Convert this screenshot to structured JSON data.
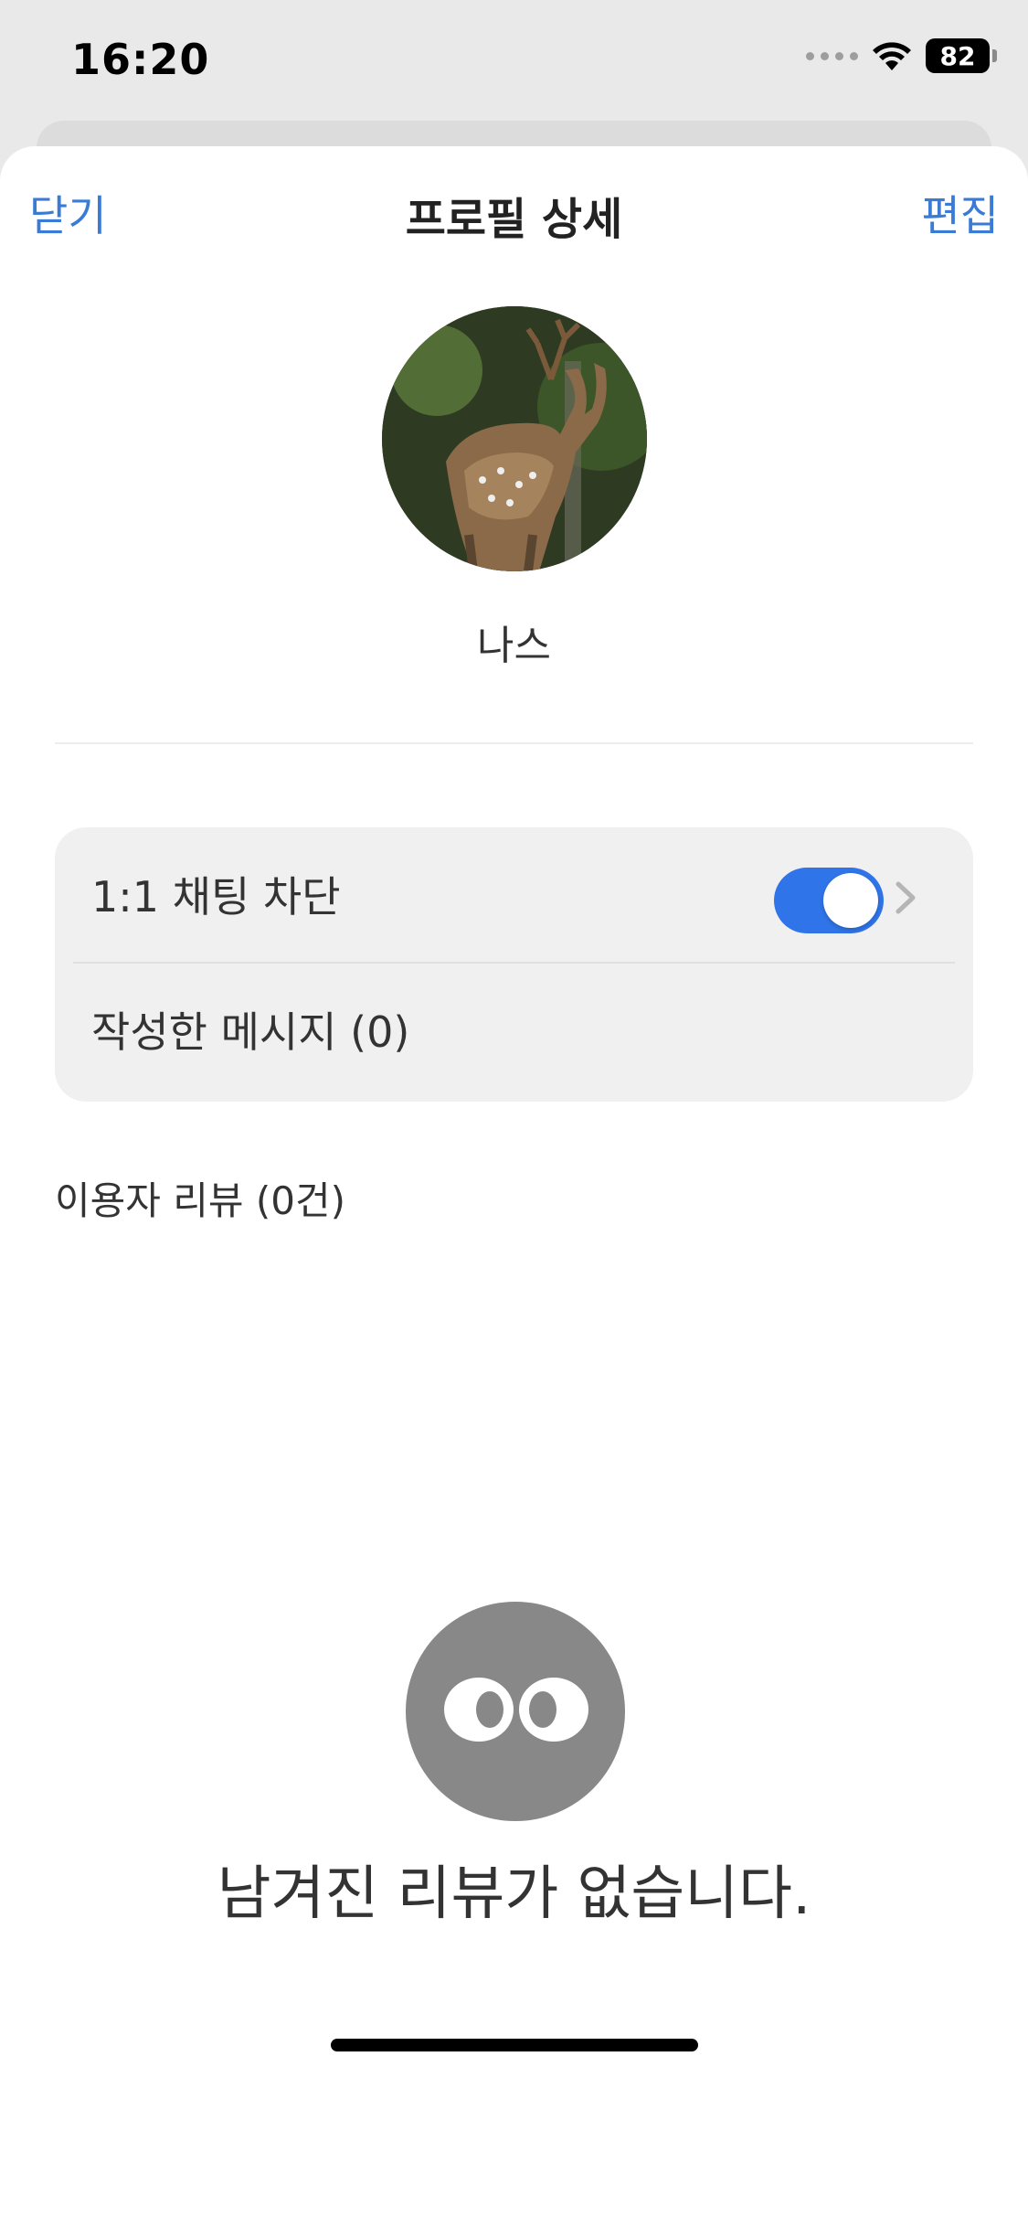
{
  "status_bar": {
    "time": "16:20",
    "battery": "82"
  },
  "nav": {
    "close_label": "닫기",
    "title": "프로필 상세",
    "edit_label": "편집"
  },
  "profile": {
    "name": "나스"
  },
  "settings": {
    "block_label": "1:1 채팅 차단",
    "block_enabled": true,
    "messages_label": "작성한 메시지 (0)"
  },
  "reviews": {
    "header": "이용자 리뷰 (0건)",
    "empty_text": "남겨진 리뷰가 없습니다."
  },
  "colors": {
    "accent": "#3a7bd5",
    "toggle_on": "#2f74e8",
    "empty_icon": "#888888"
  }
}
